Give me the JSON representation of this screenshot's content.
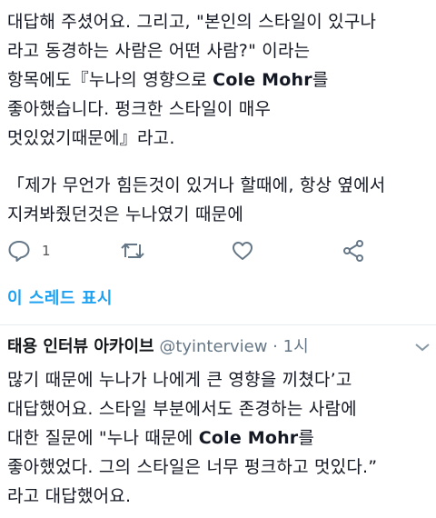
{
  "tweet1": {
    "lines_para1": [
      "대답해 주셨어요. 그리고, \"본인의 스타일이 있구나",
      "라고 동경하는 사람은 어떤 사람?\" 이라는",
      "항목에도『누나의 영향으로 ",
      "좋아했습니다. 펑크한 스타일이 매우",
      "멋있었기때문에』라고."
    ],
    "line3_bold": "Cole Mohr",
    "line3_after": "를",
    "lines_para2": [
      "「제가 무언가 힘든것이 있거나 할때에, 항상 옆에서",
      "지켜봐줬던것은 누나였기 때문에"
    ],
    "actions": {
      "reply_count": "1"
    }
  },
  "show_thread_label": "이 스레드 표시",
  "tweet2": {
    "author": "태용 인터뷰 아카이브",
    "handle": "@tyinterview",
    "separator": "·",
    "time": "1시",
    "lines": [
      "많기 때문에 누나가 나에게 큰 영향을 끼쳤다’고",
      "대답했어요. 스타일 부분에서도 존경하는 사람에",
      "대한 질문에 \"누나 때문에 ",
      "좋아했었다. 그의 스타일은 너무 펑크하고 멋있다.”",
      "라고 대답했어요."
    ],
    "line3_bold": "Cole Mohr",
    "line3_after": "를"
  },
  "colors": {
    "link": "#1da1f2",
    "icon": "#657786",
    "divider": "#e6ecf0"
  },
  "icons": [
    "reply-icon",
    "retweet-icon",
    "like-icon",
    "share-icon",
    "chevron-down-icon"
  ]
}
